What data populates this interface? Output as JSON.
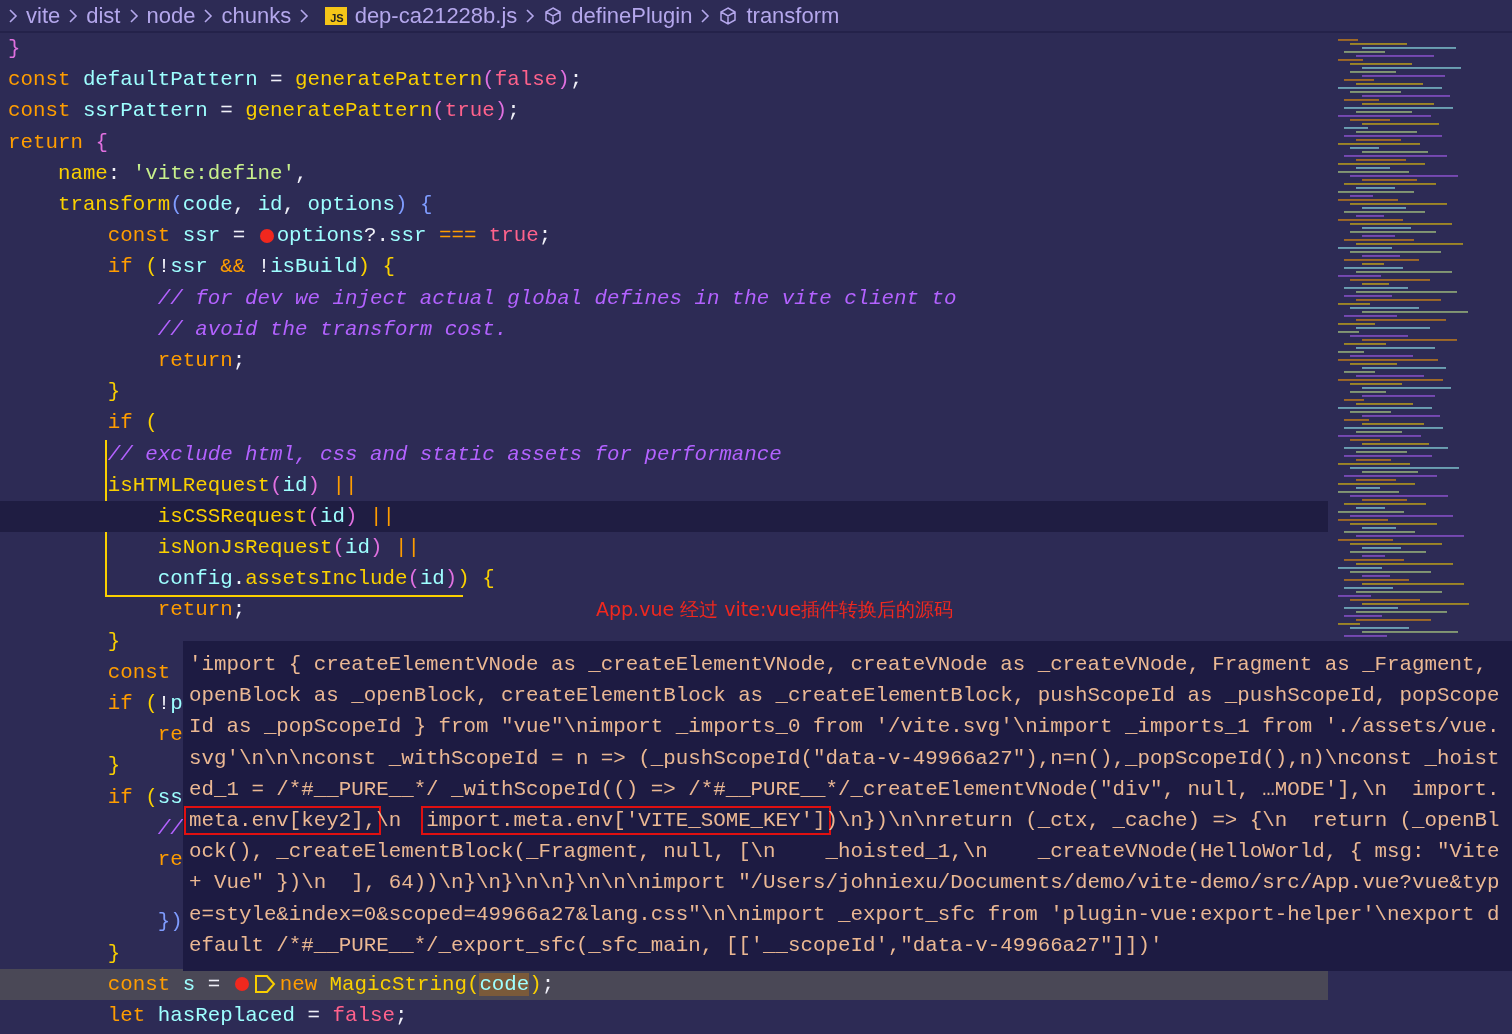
{
  "breadcrumb": [
    {
      "kind": "folder",
      "label": "vite"
    },
    {
      "kind": "folder",
      "label": "dist"
    },
    {
      "kind": "folder",
      "label": "node"
    },
    {
      "kind": "folder",
      "label": "chunks"
    },
    {
      "kind": "file",
      "label": "dep-ca21228b.js",
      "badge": "JS"
    },
    {
      "kind": "symbol",
      "label": "definePlugin"
    },
    {
      "kind": "symbol",
      "label": "transform"
    }
  ],
  "code_lines": [
    {
      "tokens": [
        {
          "text": "}",
          "kind": "bracket2"
        }
      ]
    },
    {
      "tokens": [
        {
          "text": "const ",
          "kind": "keyword"
        },
        {
          "text": "defaultPattern",
          "kind": "variable"
        },
        {
          "text": " = ",
          "kind": "punct"
        },
        {
          "text": "generatePattern",
          "kind": "function"
        },
        {
          "text": "(",
          "kind": "bracket2"
        },
        {
          "text": "false",
          "kind": "literal"
        },
        {
          "text": ")",
          "kind": "bracket2"
        },
        {
          "text": ";",
          "kind": "punct"
        }
      ]
    },
    {
      "tokens": [
        {
          "text": "const ",
          "kind": "keyword"
        },
        {
          "text": "ssrPattern",
          "kind": "variable"
        },
        {
          "text": " = ",
          "kind": "punct"
        },
        {
          "text": "generatePattern",
          "kind": "function"
        },
        {
          "text": "(",
          "kind": "bracket2"
        },
        {
          "text": "true",
          "kind": "literal"
        },
        {
          "text": ")",
          "kind": "bracket2"
        },
        {
          "text": ";",
          "kind": "punct"
        }
      ]
    },
    {
      "tokens": [
        {
          "text": "return ",
          "kind": "keyword"
        },
        {
          "text": "{",
          "kind": "bracket2"
        }
      ]
    },
    {
      "tokens": [
        {
          "text": "    name",
          "kind": "property"
        },
        {
          "text": ": ",
          "kind": "punct"
        },
        {
          "text": "'vite:define'",
          "kind": "string"
        },
        {
          "text": ",",
          "kind": "punct"
        }
      ]
    },
    {
      "tokens": [
        {
          "text": "    transform",
          "kind": "function"
        },
        {
          "text": "(",
          "kind": "bracket3"
        },
        {
          "text": "code",
          "kind": "variable"
        },
        {
          "text": ", ",
          "kind": "punct"
        },
        {
          "text": "id",
          "kind": "variable"
        },
        {
          "text": ", ",
          "kind": "punct"
        },
        {
          "text": "options",
          "kind": "variable"
        },
        {
          "text": ")",
          "kind": "bracket3"
        },
        {
          "text": " {",
          "kind": "bracket3"
        }
      ]
    },
    {
      "tokens": [
        {
          "text": "        const ",
          "kind": "keyword"
        },
        {
          "text": "ssr",
          "kind": "variable"
        },
        {
          "text": " = ",
          "kind": "punct"
        },
        {
          "kind": "breakpoint"
        },
        {
          "text": "options",
          "kind": "variable"
        },
        {
          "text": "?.",
          "kind": "punct"
        },
        {
          "text": "ssr",
          "kind": "variable"
        },
        {
          "text": " === ",
          "kind": "keyword"
        },
        {
          "text": "true",
          "kind": "literal"
        },
        {
          "text": ";",
          "kind": "punct"
        }
      ]
    },
    {
      "tokens": [
        {
          "text": "        if ",
          "kind": "keyword"
        },
        {
          "text": "(",
          "kind": "bracket1"
        },
        {
          "text": "!",
          "kind": "punct"
        },
        {
          "text": "ssr",
          "kind": "variable"
        },
        {
          "text": " && ",
          "kind": "keyword"
        },
        {
          "text": "!",
          "kind": "punct"
        },
        {
          "text": "isBuild",
          "kind": "variable"
        },
        {
          "text": ")",
          "kind": "bracket1"
        },
        {
          "text": " {",
          "kind": "bracket1"
        }
      ]
    },
    {
      "tokens": [
        {
          "text": "            // for dev we inject actual global defines in the vite client to",
          "kind": "comment"
        }
      ]
    },
    {
      "tokens": [
        {
          "text": "            // avoid the transform cost.",
          "kind": "comment"
        }
      ]
    },
    {
      "tokens": [
        {
          "text": "            return",
          "kind": "keyword"
        },
        {
          "text": ";",
          "kind": "punct"
        }
      ]
    },
    {
      "tokens": [
        {
          "text": "        }",
          "kind": "bracket1"
        }
      ]
    },
    {
      "tokens": [
        {
          "text": "        if ",
          "kind": "keyword"
        },
        {
          "text": "(",
          "kind": "bracket1"
        }
      ]
    },
    {
      "tokens": [
        {
          "text": "        // exclude html, css and static assets for performance",
          "kind": "comment"
        }
      ]
    },
    {
      "tokens": [
        {
          "text": "        isHTMLRequest",
          "kind": "function"
        },
        {
          "text": "(",
          "kind": "bracket2"
        },
        {
          "text": "id",
          "kind": "variable"
        },
        {
          "text": ")",
          "kind": "bracket2"
        },
        {
          "text": " ||",
          "kind": "keyword"
        }
      ]
    },
    {
      "cursor_line": true,
      "tokens": [
        {
          "text": "            isCSSRequest",
          "kind": "function"
        },
        {
          "text": "(",
          "kind": "bracket2"
        },
        {
          "text": "id",
          "kind": "variable"
        },
        {
          "text": ")",
          "kind": "bracket2"
        },
        {
          "text": " ||",
          "kind": "keyword"
        }
      ]
    },
    {
      "tokens": [
        {
          "text": "            isNonJsRequest",
          "kind": "function"
        },
        {
          "text": "(",
          "kind": "bracket2"
        },
        {
          "text": "id",
          "kind": "variable"
        },
        {
          "text": ")",
          "kind": "bracket2"
        },
        {
          "text": " ||",
          "kind": "keyword"
        }
      ]
    },
    {
      "tokens": [
        {
          "text": "            config",
          "kind": "variable"
        },
        {
          "text": ".",
          "kind": "punct"
        },
        {
          "text": "assetsInclude",
          "kind": "function"
        },
        {
          "text": "(",
          "kind": "bracket2"
        },
        {
          "text": "id",
          "kind": "variable"
        },
        {
          "text": ")",
          "kind": "bracket2"
        },
        {
          "text": ") {",
          "kind": "bracket1"
        }
      ]
    },
    {
      "note": "App.vue 经过 vite:vue插件转换后的源码",
      "tokens": [
        {
          "text": "            return",
          "kind": "keyword"
        },
        {
          "text": ";",
          "kind": "punct"
        }
      ]
    },
    {
      "tokens": [
        {
          "text": "        }",
          "kind": "bracket1"
        }
      ]
    },
    {
      "tokens": [
        {
          "text": "        const",
          "kind": "keyword"
        }
      ]
    },
    {
      "tokens": [
        {
          "text": "        if ",
          "kind": "keyword"
        },
        {
          "text": "(",
          "kind": "bracket1"
        },
        {
          "text": "!",
          "kind": "punct"
        },
        {
          "text": "p",
          "kind": "variable"
        }
      ]
    },
    {
      "tokens": [
        {
          "text": "            re",
          "kind": "keyword"
        }
      ]
    },
    {
      "tokens": [
        {
          "text": "        }",
          "kind": "bracket1"
        }
      ]
    },
    {
      "tokens": [
        {
          "text": "        if ",
          "kind": "keyword"
        },
        {
          "text": "(",
          "kind": "bracket1"
        },
        {
          "text": "ss",
          "kind": "variable"
        }
      ]
    },
    {
      "tokens": [
        {
          "text": "            //",
          "kind": "comment"
        }
      ]
    },
    {
      "tokens": [
        {
          "text": "            re",
          "kind": "keyword"
        }
      ]
    },
    {
      "blank_line_before": true,
      "tokens": [
        {
          "text": "            })",
          "kind": "bracket3"
        }
      ]
    },
    {
      "tokens": [
        {
          "text": "        }",
          "kind": "bracket1"
        }
      ]
    },
    {
      "paused_here": true,
      "tokens": [
        {
          "text": "        const ",
          "kind": "keyword"
        },
        {
          "text": "s",
          "kind": "variable"
        },
        {
          "text": " = ",
          "kind": "punct"
        },
        {
          "kind": "breakpoint"
        },
        {
          "kind": "step"
        },
        {
          "text": "new ",
          "kind": "keyword"
        },
        {
          "text": "MagicString",
          "kind": "function"
        },
        {
          "text": "(",
          "kind": "bracket1"
        },
        {
          "text": "code",
          "kind": "variable",
          "match": true
        },
        {
          "text": ")",
          "kind": "bracket1"
        },
        {
          "text": ";",
          "kind": "punct"
        }
      ]
    },
    {
      "tokens": [
        {
          "text": "        let ",
          "kind": "keyword"
        },
        {
          "text": "hasReplaced",
          "kind": "variable"
        },
        {
          "text": " = ",
          "kind": "punct"
        },
        {
          "text": "false",
          "kind": "literal"
        },
        {
          "text": ";",
          "kind": "punct"
        }
      ]
    }
  ],
  "hover_tooltip": {
    "lines": [
      [
        {
          "text": "'import { createElementVNode as _createElementVNode, createVNode as _createVNode, Fragment as _Fragment,"
        }
      ],
      [
        {
          "text": "openBlock as _openBlock, createElementBlock as _createElementBlock, pushScopeId as _pushScopeId, popScope"
        }
      ],
      [
        {
          "text": "Id as _popScopeId } from \"vue\"\\nimport _imports_0 from '/vite.svg'\\nimport _imports_1 from './assets/vue."
        }
      ],
      [
        {
          "text": "svg'\\n\\n\\nconst _withScopeId = n => (_pushScopeId(\"data-v-49966a27\"),n=n(),_popScopeId(),n)\\nconst _hoist"
        }
      ],
      [
        {
          "text": "ed_1 = /*#__PURE__*/ _withScopeId(() => /*#__PURE__*/_createElementVNode(\"div\", null, …MODE'],\\n  import."
        }
      ],
      [
        {
          "text": "meta.env[key2],",
          "boxed": true
        },
        {
          "text": "\\n  "
        },
        {
          "text": "import.meta.env['VITE_SOME_KEY']",
          "boxed": true
        },
        {
          "text": ")\\n})\\n\\nreturn (_ctx, _cache) => {\\n  return (_openBl"
        }
      ],
      [
        {
          "text": "ock(), _createElementBlock(_Fragment, null, [\\n    _hoisted_1,\\n    _createVNode(HelloWorld, { msg: \"Vite"
        }
      ],
      [
        {
          "text": "+ Vue\" })\\n  ], 64))\\n}\\n}\\n\\n}\\n\\n\\nimport \"/Users/johniexu/Documents/demo/vite-demo/src/App.vue?vue&typ"
        }
      ],
      [
        {
          "text": "e=style&index=0&scoped=49966a27&lang.css\"\\n\\nimport _export_sfc from 'plugin-vue:export-helper'\\nexport d"
        }
      ],
      [
        {
          "text": "efault /*#__PURE__*/_export_sfc(_sfc_main, [['__scopeId',\"data-v-49966a27\"]])'"
        }
      ]
    ]
  }
}
